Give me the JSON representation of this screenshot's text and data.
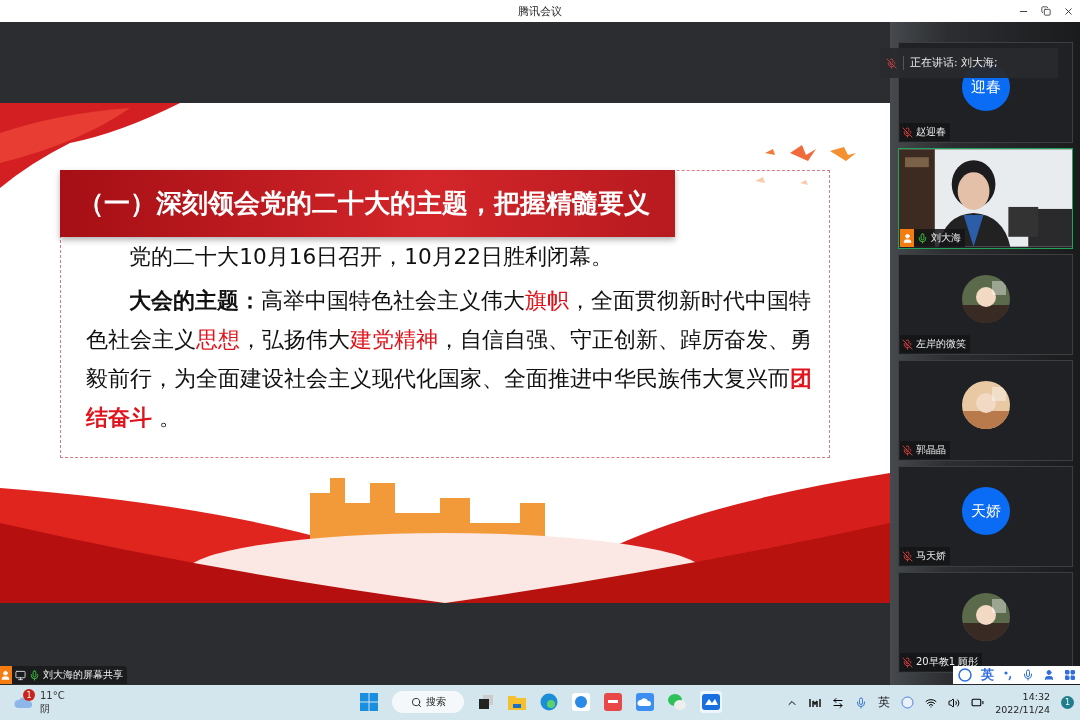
{
  "window": {
    "title": "腾讯会议"
  },
  "slide": {
    "heading": "（一）深刻领会党的二十大的主题，把握精髓要义",
    "paragraphs": [
      [
        {
          "text": "党的二十大10月16日召开，10月22日胜利闭幕。",
          "kind": "plain"
        }
      ],
      [
        {
          "text": "大会的主题：",
          "kind": "bold"
        },
        {
          "text": "高举中国特色社会主义伟大",
          "kind": "plain"
        },
        {
          "text": "旗帜",
          "kind": "red"
        },
        {
          "text": "，全面贯彻新时代中国特色社会主义",
          "kind": "plain"
        },
        {
          "text": "思想",
          "kind": "red"
        },
        {
          "text": "，弘扬伟大",
          "kind": "plain"
        },
        {
          "text": "建党精神",
          "kind": "red"
        },
        {
          "text": "，自信自强、守正创新、踔厉奋发、勇毅前行，为全面建设社会主义现代化国家、全面推进中华民族伟大复兴而",
          "kind": "plain"
        },
        {
          "text": "团结奋斗",
          "kind": "redbold"
        },
        {
          "text": " 。",
          "kind": "plain"
        }
      ]
    ]
  },
  "speaking": {
    "label": "正在讲话: 刘大海;"
  },
  "participants": [
    {
      "name": "赵迎春",
      "kind": "initials",
      "avatar_text": "迎春",
      "mic_on": false,
      "speaking": false,
      "host": false
    },
    {
      "name": "刘大海",
      "kind": "video",
      "mic_on": true,
      "speaking": true,
      "host": true
    },
    {
      "name": "左岸的微笑",
      "mic_on": false,
      "speaking": false,
      "host": false
    },
    {
      "name": "郭晶晶",
      "mic_on": false,
      "speaking": false,
      "host": false
    },
    {
      "name": "马天娇",
      "kind": "initials",
      "avatar_text": "天娇",
      "mic_on": false,
      "speaking": false,
      "host": false
    },
    {
      "name": "20早教1 顾彤",
      "mic_on": false,
      "speaking": false,
      "host": false
    }
  ],
  "share_label": {
    "text": "刘大海的屏幕共享"
  },
  "ime_toolbar": {
    "language": "英"
  },
  "taskbar": {
    "weather": {
      "temperature": "11°C",
      "condition": "阴",
      "badge": "1"
    },
    "search": {
      "label": "搜索"
    },
    "tray": {
      "ime": "英",
      "time": "14:32",
      "date": "2022/11/24",
      "notification_count": "1"
    }
  }
}
